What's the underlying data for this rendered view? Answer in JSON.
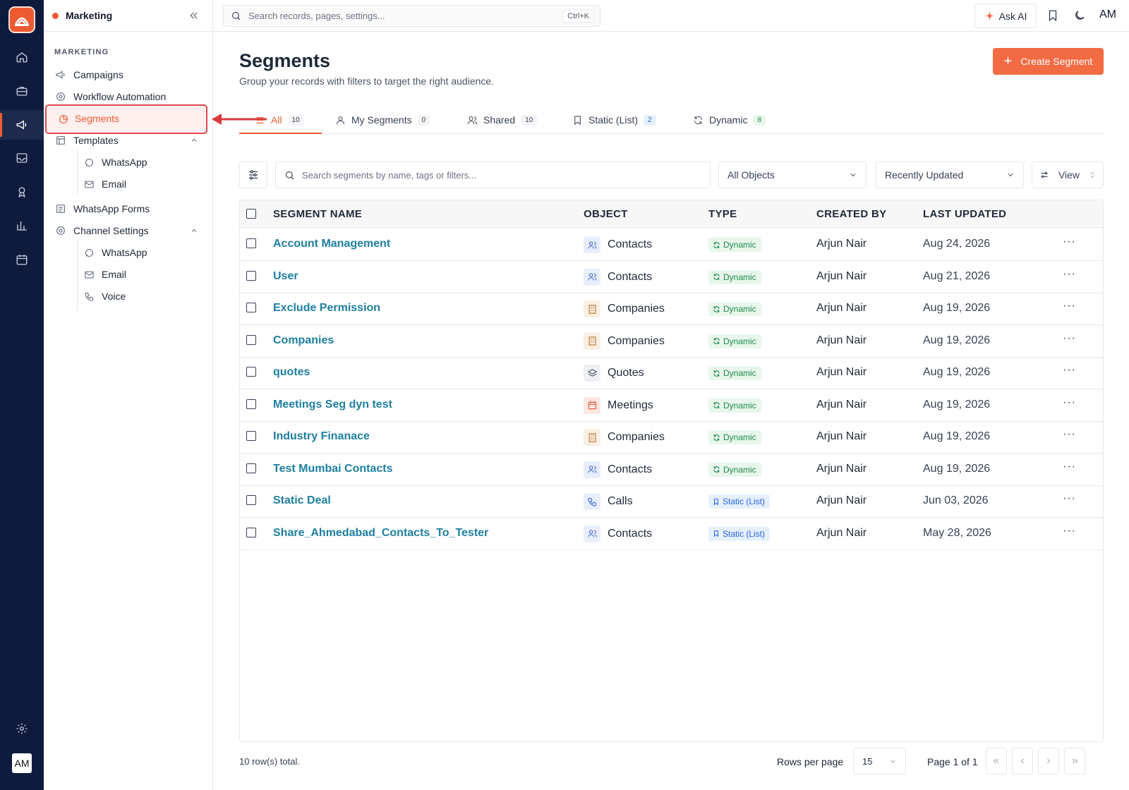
{
  "workspace": {
    "name": "Marketing"
  },
  "sidebar": {
    "section_label": "MARKETING",
    "items": [
      {
        "label": "Campaigns",
        "icon": "megaphone-icon"
      },
      {
        "label": "Workflow Automation",
        "icon": "workflow-icon"
      },
      {
        "label": "Segments",
        "icon": "pie-chart-icon",
        "active": true
      },
      {
        "label": "Templates",
        "icon": "template-icon",
        "expanded": true,
        "children": [
          {
            "label": "WhatsApp",
            "icon": "whatsapp-icon"
          },
          {
            "label": "Email",
            "icon": "mail-icon"
          }
        ]
      },
      {
        "label": "WhatsApp Forms",
        "icon": "form-icon"
      },
      {
        "label": "Channel Settings",
        "icon": "settings-icon",
        "expanded": true,
        "children": [
          {
            "label": "WhatsApp",
            "icon": "whatsapp-icon"
          },
          {
            "label": "Email",
            "icon": "mail-icon"
          },
          {
            "label": "Voice",
            "icon": "phone-icon"
          }
        ]
      }
    ]
  },
  "rail": {
    "avatar": "AM",
    "icons": [
      "home-icon",
      "briefcase-icon",
      "megaphone-icon",
      "inbox-icon",
      "award-icon",
      "bar-chart-icon",
      "calendar-icon",
      "settings-icon"
    ]
  },
  "topbar": {
    "search_placeholder": "Search records, pages, settings...",
    "shortcut": "Ctrl+K",
    "ask_ai": "Ask AI",
    "avatar": "AM"
  },
  "page": {
    "title": "Segments",
    "subtitle": "Group your records with filters to target the right audience.",
    "create_button": "Create Segment"
  },
  "tabs": [
    {
      "label": "All",
      "count": "10",
      "icon": "list-icon",
      "active": true
    },
    {
      "label": "My Segments",
      "count": "0",
      "icon": "user-icon"
    },
    {
      "label": "Shared",
      "count": "10",
      "icon": "users-icon"
    },
    {
      "label": "Static (List)",
      "count": "2",
      "icon": "bookmark-icon"
    },
    {
      "label": "Dynamic",
      "count": "8",
      "icon": "refresh-icon"
    }
  ],
  "filters": {
    "search_placeholder": "Search segments by name, tags or filters...",
    "object_select": "All Objects",
    "sort_select": "Recently Updated",
    "view_button": "View"
  },
  "table": {
    "columns": [
      "SEGMENT NAME",
      "OBJECT",
      "TYPE",
      "CREATED BY",
      "LAST UPDATED"
    ],
    "rows": [
      {
        "name": "Account Management",
        "object": "Contacts",
        "type": "Dynamic",
        "created_by": "Arjun Nair",
        "updated": "Aug 24, 2026"
      },
      {
        "name": "User",
        "object": "Contacts",
        "type": "Dynamic",
        "created_by": "Arjun Nair",
        "updated": "Aug 21, 2026"
      },
      {
        "name": "Exclude Permission",
        "object": "Companies",
        "type": "Dynamic",
        "created_by": "Arjun Nair",
        "updated": "Aug 19, 2026"
      },
      {
        "name": "Companies",
        "object": "Companies",
        "type": "Dynamic",
        "created_by": "Arjun Nair",
        "updated": "Aug 19, 2026"
      },
      {
        "name": "quotes",
        "object": "Quotes",
        "type": "Dynamic",
        "created_by": "Arjun Nair",
        "updated": "Aug 19, 2026"
      },
      {
        "name": "Meetings Seg dyn test",
        "object": "Meetings",
        "type": "Dynamic",
        "created_by": "Arjun Nair",
        "updated": "Aug 19, 2026"
      },
      {
        "name": "Industry Finanace",
        "object": "Companies",
        "type": "Dynamic",
        "created_by": "Arjun Nair",
        "updated": "Aug 19, 2026"
      },
      {
        "name": "Test Mumbai Contacts",
        "object": "Contacts",
        "type": "Dynamic",
        "created_by": "Arjun Nair",
        "updated": "Aug 19, 2026"
      },
      {
        "name": "Static Deal",
        "object": "Calls",
        "type": "Static (List)",
        "created_by": "Arjun Nair",
        "updated": "Jun 03, 2026"
      },
      {
        "name": "Share_Ahmedabad_Contacts_To_Tester",
        "object": "Contacts",
        "type": "Static (List)",
        "created_by": "Arjun Nair",
        "updated": "May 28, 2026"
      }
    ]
  },
  "footer": {
    "total": "10 row(s) total.",
    "rows_per_page_label": "Rows per page",
    "rows_per_page": "15",
    "page_label": "Page 1 of 1"
  },
  "colors": {
    "accent": "#ee5b33",
    "rail_bg": "#0f1b3d",
    "link": "#1d7fa0",
    "dynamic": "#1f8a4c",
    "static": "#2563eb"
  }
}
